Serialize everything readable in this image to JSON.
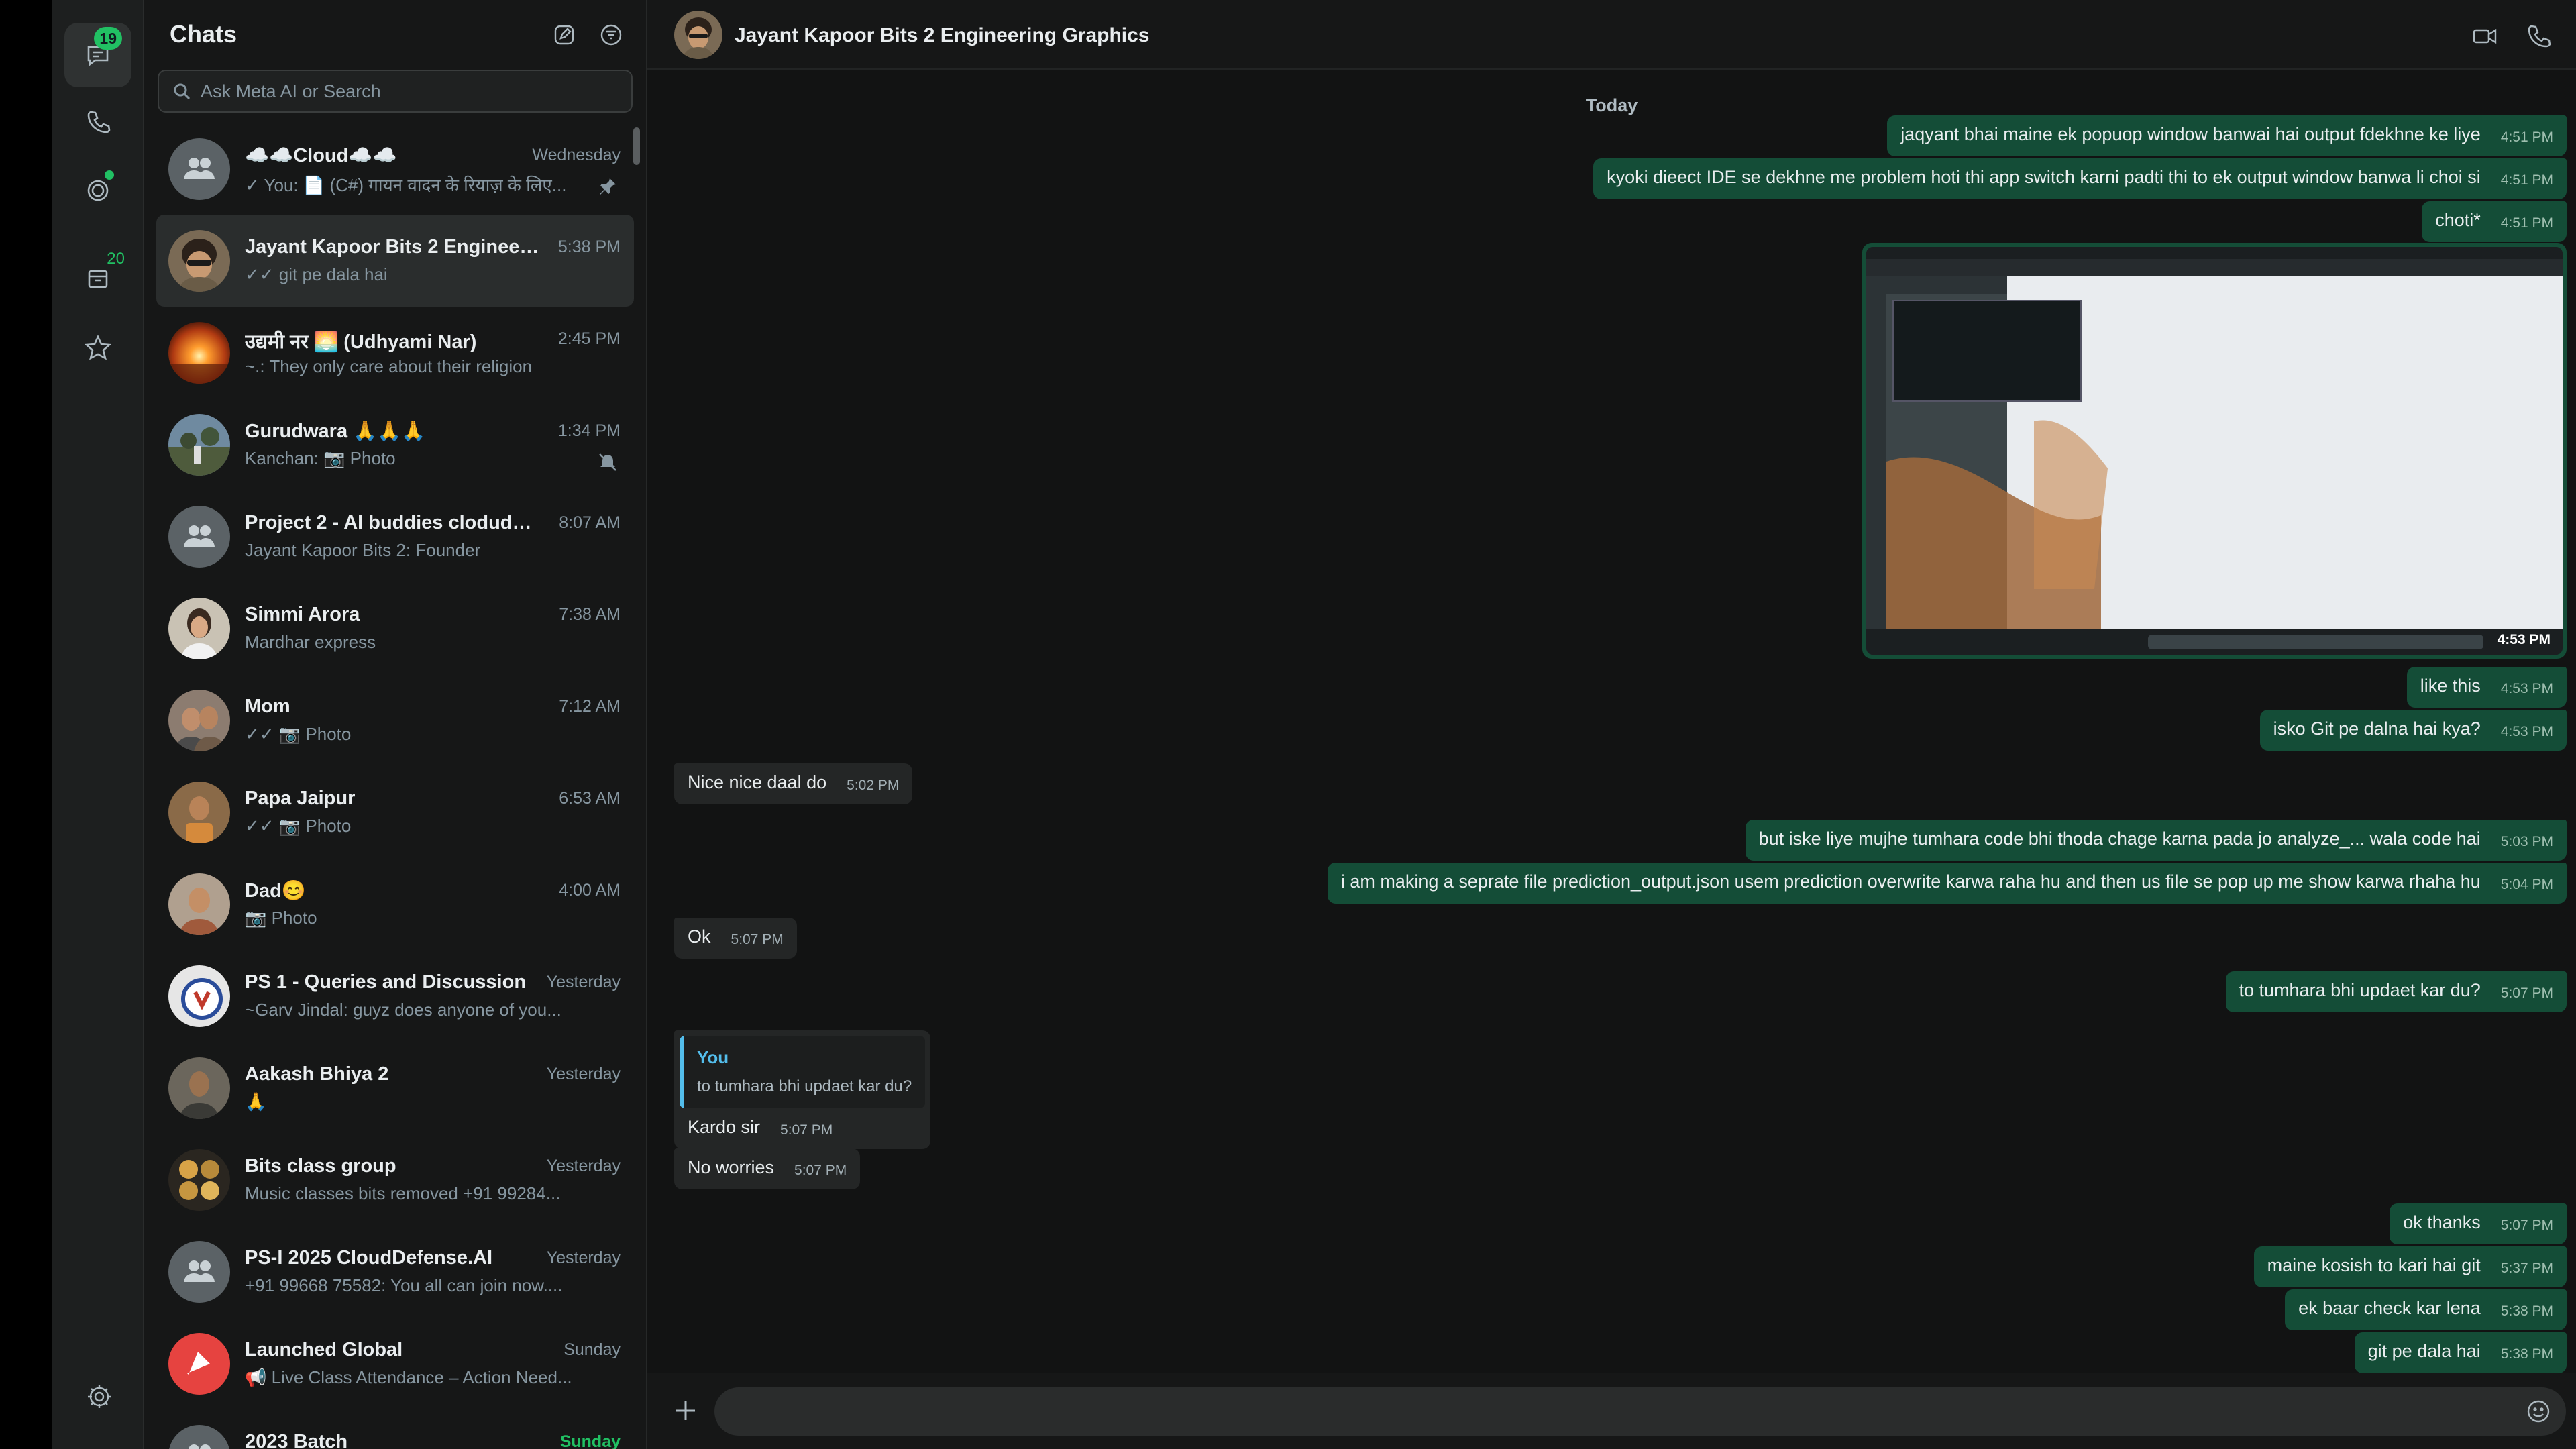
{
  "rail": {
    "chats_badge": "19",
    "communities_count": "20"
  },
  "sidebar": {
    "title": "Chats",
    "search_placeholder": "Ask Meta AI or Search",
    "chats": [
      {
        "name": "☁️☁️Cloud☁️☁️",
        "time": "Wednesday",
        "preview": "✓ You: 📄 (C#) गायन वादन के रियाज़ के लिए...",
        "avatar": "group",
        "pinned": true
      },
      {
        "name": "Jayant Kapoor Bits 2 Engineering Graphics",
        "time": "5:38 PM",
        "preview": "✓✓ git pe dala hai",
        "avatar": "person1",
        "selected": true
      },
      {
        "name": "उद्यमी नर 🌅 (Udhyami Nar)",
        "time": "2:45 PM",
        "preview": "~.: They only care about their religion",
        "avatar": "sunset"
      },
      {
        "name": "Gurudwara 🙏🙏🙏",
        "time": "1:34 PM",
        "preview": "Kanchan: 📷 Photo",
        "avatar": "outdoor",
        "muted": true
      },
      {
        "name": "Project 2 - AI buddies clodudde...",
        "time": "8:07 AM",
        "preview": "Jayant Kapoor Bits 2: Founder",
        "avatar": "group"
      },
      {
        "name": "Simmi Arora",
        "time": "7:38 AM",
        "preview": "Mardhar express",
        "avatar": "person2"
      },
      {
        "name": "Mom",
        "time": "7:12 AM",
        "preview": "✓✓ 📷 Photo",
        "avatar": "person3"
      },
      {
        "name": "Papa Jaipur",
        "time": "6:53 AM",
        "preview": "✓✓ 📷 Photo",
        "avatar": "person4"
      },
      {
        "name": "Dad😊",
        "time": "4:00 AM",
        "preview": "📷 Photo",
        "avatar": "person5"
      },
      {
        "name": "PS 1 - Queries and Discussion",
        "time": "Yesterday",
        "preview": "~Garv Jindal: guyz does anyone of you...",
        "avatar": "logo"
      },
      {
        "name": "Aakash Bhiya 2",
        "time": "Yesterday",
        "preview": "🙏",
        "avatar": "person6"
      },
      {
        "name": "Bits class group",
        "time": "Yesterday",
        "preview": "Music classes bits removed +91 99284...",
        "avatar": "collage"
      },
      {
        "name": "PS-I 2025 CloudDefense.AI",
        "time": "Yesterday",
        "preview": "+91 99668 75582: You all can join now....",
        "avatar": "group"
      },
      {
        "name": "Launched Global",
        "time": "Sunday",
        "preview": "📢 Live Class Attendance – Action Need...",
        "avatar": "launched"
      },
      {
        "name": "2023 Batch",
        "time": "Sunday",
        "preview": "",
        "avatar": "group",
        "time_green": true
      }
    ]
  },
  "conversation": {
    "title": "Jayant Kapoor Bits 2 Engineering Graphics",
    "date_label": "Today",
    "messages": [
      {
        "dir": "out",
        "text": "jaqyant bhai maine ek popuop window banwai hai output fdekhne ke liye",
        "time": "4:51 PM"
      },
      {
        "dir": "out",
        "text": "kyoki dieect IDE se dekhne me problem hoti thi app switch karni padti thi to ek output window banwa li choi si",
        "time": "4:51 PM"
      },
      {
        "dir": "out",
        "text": "choti*",
        "time": "4:51 PM"
      },
      {
        "dir": "out",
        "text": "",
        "time": "4:53 PM",
        "image": true
      },
      {
        "dir": "out",
        "text": "like this",
        "time": "4:53 PM"
      },
      {
        "dir": "out",
        "text": "isko Git pe dalna hai kya?",
        "time": "4:53 PM"
      },
      {
        "dir": "in",
        "text": "Nice nice daal do",
        "time": "5:02 PM"
      },
      {
        "dir": "out",
        "text": "but iske liye mujhe tumhara code bhi thoda chage karna pada jo analyze_... wala code hai",
        "time": "5:03 PM"
      },
      {
        "dir": "out",
        "text": "i am making a seprate file prediction_output.json usem prediction overwrite karwa raha hu and then us file se pop up me show karwa rhaha hu",
        "time": "5:04 PM"
      },
      {
        "dir": "in",
        "text": "Ok",
        "time": "5:07 PM"
      },
      {
        "dir": "out",
        "text": "to tumhara bhi updaet kar du?",
        "time": "5:07 PM"
      },
      {
        "dir": "in",
        "text": "Kardo sir",
        "time": "5:07 PM",
        "quote_name": "You",
        "quote_text": "to tumhara bhi updaet kar du?"
      },
      {
        "dir": "in",
        "text": "No worries",
        "time": "5:07 PM"
      },
      {
        "dir": "out",
        "text": "ok thanks",
        "time": "5:07 PM"
      },
      {
        "dir": "out",
        "text": "maine kosish to kari hai git",
        "time": "5:37 PM"
      },
      {
        "dir": "out",
        "text": "ek baar check kar lena",
        "time": "5:38 PM"
      },
      {
        "dir": "out",
        "text": "git pe dala hai",
        "time": "5:38 PM"
      }
    ]
  },
  "composer": {
    "placeholder": ""
  },
  "colors": {
    "accent": "#21c063",
    "outgoing_bubble": "#144d37",
    "incoming_bubble": "#242626",
    "background": "#161717"
  }
}
